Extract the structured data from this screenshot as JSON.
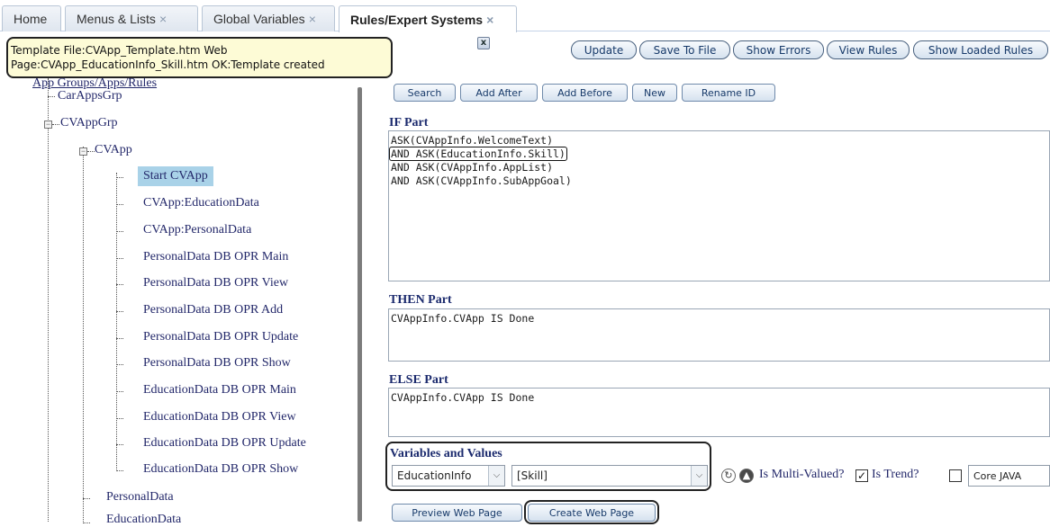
{
  "tabs": [
    {
      "label": "Home",
      "closable": false
    },
    {
      "label": "Menus & Lists",
      "closable": true
    },
    {
      "label": "Global Variables",
      "closable": true
    },
    {
      "label": "Rules/Expert Systems",
      "closable": true,
      "active": true
    }
  ],
  "close_glyph": "×",
  "notice": {
    "line1": "Template File:CVApp_Template.htm Web",
    "line2": "Page:CVApp_EducationInfo_Skill.htm OK:Template created",
    "close_label": "x"
  },
  "toolbar": {
    "update": "Update",
    "save_to_file": "Save To File",
    "show_errors": "Show Errors",
    "view_rules": "View Rules",
    "show_loaded_rules": "Show Loaded Rules"
  },
  "rule_toolbar": {
    "search": "Search",
    "add_after": "Add After",
    "add_before": "Add Before",
    "new": "New",
    "rename_id": "Rename ID"
  },
  "tree": {
    "root_link": "App Groups/Apps/Rules",
    "car_apps_grp": "CarAppsGrp",
    "cvapp_grp": "CVAppGrp",
    "cvapp": "CVApp",
    "rules": [
      "Start CVApp",
      "CVApp:EducationData",
      "CVApp:PersonalData",
      "PersonalData DB OPR Main",
      "PersonalData DB OPR View",
      "PersonalData DB OPR Add",
      "PersonalData DB OPR Update",
      "PersonalData DB OPR Show",
      "EducationData DB OPR Main",
      "EducationData DB OPR View",
      "EducationData DB OPR Update",
      "EducationData DB OPR Show"
    ],
    "personal_data": "PersonalData",
    "education_data": "EducationData",
    "expander_minus": "−"
  },
  "if_part": {
    "label": "IF Part",
    "lines": [
      "ASK(CVAppInfo.WelcomeText)",
      "AND ASK(EducationInfo.Skill)",
      "AND ASK(CVAppInfo.AppList)",
      "AND ASK(CVAppInfo.SubAppGoal)"
    ]
  },
  "then_part": {
    "label": "THEN Part",
    "text": "CVAppInfo.CVApp IS Done"
  },
  "else_part": {
    "label": "ELSE Part",
    "text": "CVAppInfo.CVApp IS Done"
  },
  "variables": {
    "label": "Variables and Values",
    "variable_select": "EducationInfo",
    "value_select": "[Skill]",
    "multi_valued_label": "Is Multi-Valued?",
    "multi_valued_checked": false,
    "trend_label": "Is Trend?",
    "trend_checked": true,
    "extra_checked": false,
    "value_input": "Core JAVA",
    "check_glyph": "✓",
    "arrow_glyph": "⌵",
    "refresh_glyph": "↻",
    "up_glyph": "▲"
  },
  "bottom_buttons": {
    "preview": "Preview Web Page",
    "create": "Create Web Page"
  },
  "colors": {
    "tab_active_bg": "#ffffff",
    "notice_bg": "#fdfbd6",
    "selected_bg": "#a9d2e8",
    "link": "#23286a",
    "section_label": "#1c2b6e"
  }
}
